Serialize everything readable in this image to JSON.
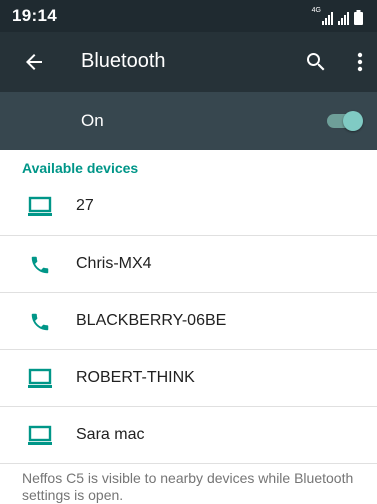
{
  "status_bar": {
    "time": "19:14",
    "network_label": "4G"
  },
  "toolbar": {
    "title": "Bluetooth",
    "back_icon": "arrow-back-icon",
    "search_icon": "search-icon",
    "more_icon": "more-vert-icon"
  },
  "bluetooth_switch": {
    "label": "On",
    "state": true,
    "accent_color": "#80cbc4"
  },
  "available_devices": {
    "header": "Available devices",
    "accent_color": "#009688",
    "items": [
      {
        "name": "27",
        "icon": "laptop-icon"
      },
      {
        "name": "Chris-MX4",
        "icon": "phone-icon"
      },
      {
        "name": "BLACKBERRY-06BE",
        "icon": "phone-icon"
      },
      {
        "name": "ROBERT-THINK",
        "icon": "laptop-icon"
      },
      {
        "name": "Sara mac",
        "icon": "laptop-icon"
      }
    ]
  },
  "footer_text": "Neffos C5 is visible to nearby devices while Bluetooth settings is open."
}
